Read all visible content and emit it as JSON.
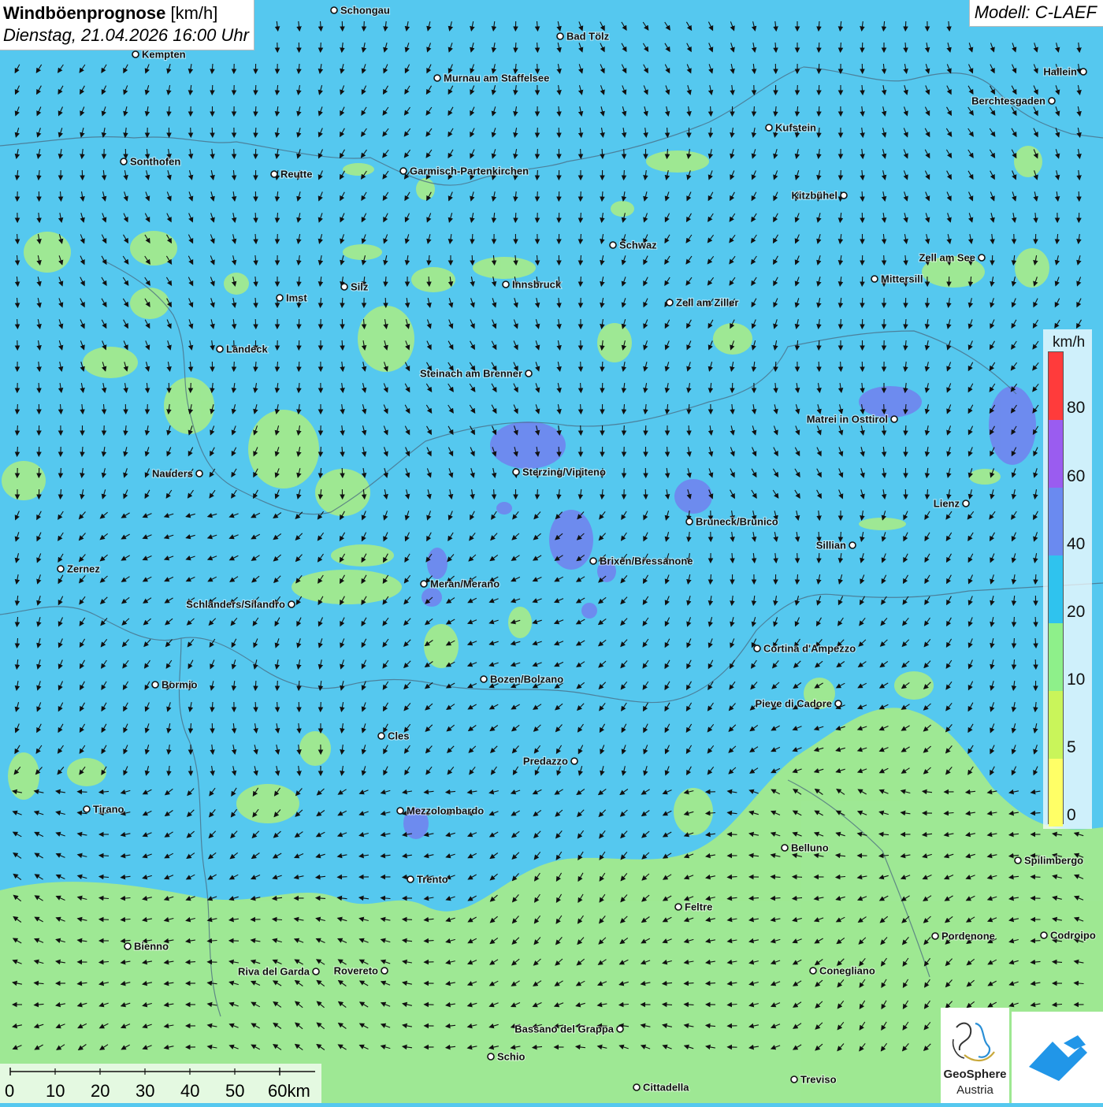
{
  "header": {
    "title": "Windböenprognose",
    "unit": "[km/h]",
    "datetime": "Dienstag, 21.04.2026 16:00 Uhr"
  },
  "model": "Modell: C-LAEF",
  "legend": {
    "unit": "km/h",
    "ticks": [
      "80",
      "60",
      "40",
      "20",
      "10",
      "5",
      "0"
    ],
    "colors": [
      "#ff3b3b",
      "#9a5cf0",
      "#6a8af0",
      "#2fc3ee",
      "#8ef08a",
      "#c9f55a",
      "#ffff66"
    ]
  },
  "background_colors": {
    "wind_20_40": "#55c8ef",
    "wind_10_20": "#a2ea8e",
    "wind_40_60": "#6f88ee"
  },
  "scalebar": {
    "labels": [
      "0",
      "10",
      "20",
      "30",
      "40",
      "50",
      "60km"
    ]
  },
  "cities": [
    {
      "name": "Schongau"
    },
    {
      "name": "Bad Tölz"
    },
    {
      "name": "Kempten"
    },
    {
      "name": "Murnau am Staffelsee"
    },
    {
      "name": "Hallein"
    },
    {
      "name": "Berchtesgaden"
    },
    {
      "name": "Kufstein"
    },
    {
      "name": "Sonthofen"
    },
    {
      "name": "Reutte"
    },
    {
      "name": "Garmisch-Partenkirchen"
    },
    {
      "name": "Kitzbühel"
    },
    {
      "name": "Schwaz"
    },
    {
      "name": "Zell am See"
    },
    {
      "name": "Mittersill"
    },
    {
      "name": "Innsbruck"
    },
    {
      "name": "Imst"
    },
    {
      "name": "Silz"
    },
    {
      "name": "Zell am Ziller"
    },
    {
      "name": "Landeck"
    },
    {
      "name": "Steinach am Brenner"
    },
    {
      "name": "Matrei in Osttirol"
    },
    {
      "name": "Nauders"
    },
    {
      "name": "Sterzing/Vipiteno"
    },
    {
      "name": "Lienz"
    },
    {
      "name": "Bruneck/Brunico"
    },
    {
      "name": "Sillian"
    },
    {
      "name": "Zernez"
    },
    {
      "name": "Brixen/Bressanone"
    },
    {
      "name": "Meran/Merano"
    },
    {
      "name": "Schlanders/Silandro"
    },
    {
      "name": "Cortina d'Ampezzo"
    },
    {
      "name": "Bozen/Bolzano"
    },
    {
      "name": "Bormio"
    },
    {
      "name": "Pieve di Cadore"
    },
    {
      "name": "Cles"
    },
    {
      "name": "Predazzo"
    },
    {
      "name": "Tirano"
    },
    {
      "name": "Mezzolombardo"
    },
    {
      "name": "Belluno"
    },
    {
      "name": "Spilimbergo"
    },
    {
      "name": "Trento"
    },
    {
      "name": "Feltre"
    },
    {
      "name": "Pordenone"
    },
    {
      "name": "Codroipo"
    },
    {
      "name": "Bienno"
    },
    {
      "name": "Riva del Garda"
    },
    {
      "name": "Rovereto"
    },
    {
      "name": "Conegliano"
    },
    {
      "name": "Bassano del Grappa"
    },
    {
      "name": "Schio"
    },
    {
      "name": "Treviso"
    },
    {
      "name": "Cittadella"
    }
  ],
  "logos": {
    "geosphere_line1": "GeoSphere",
    "geosphere_line2": "Austria"
  }
}
